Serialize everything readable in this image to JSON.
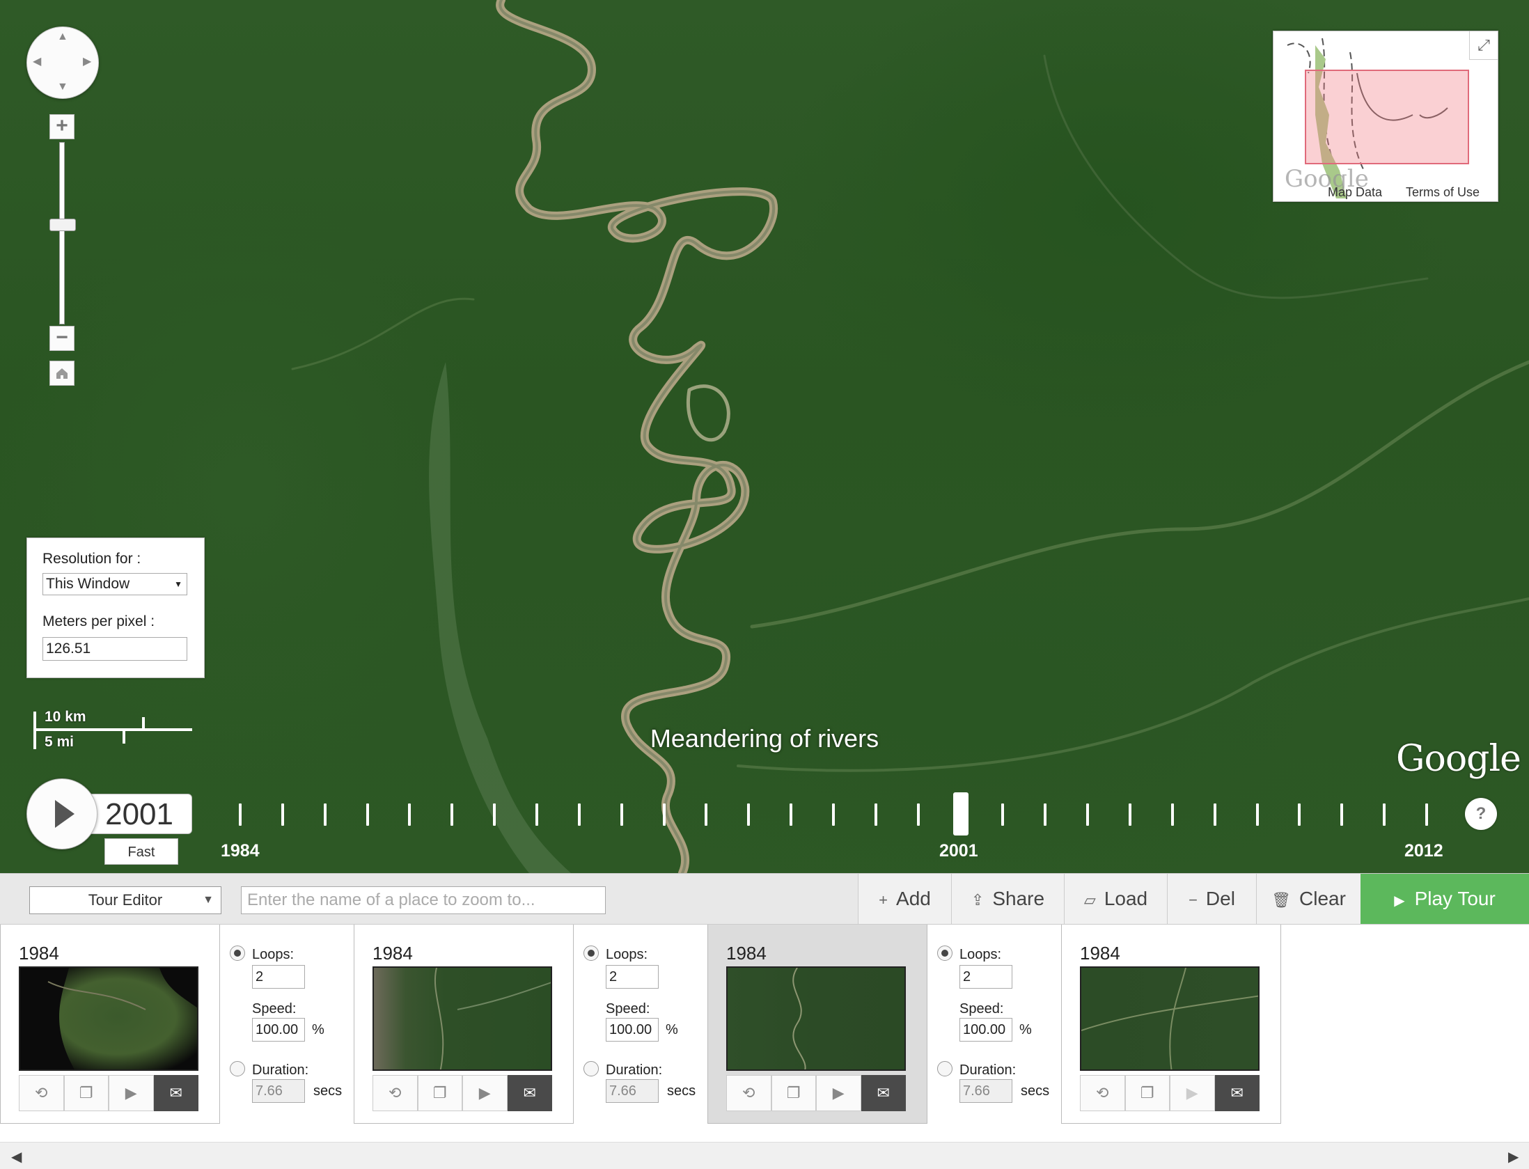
{
  "map": {
    "caption": "Meandering of rivers",
    "google_logo": "Google",
    "scale": {
      "metric": "10 km",
      "imperial": "5 mi"
    },
    "minimap": {
      "map_data": "Map Data",
      "terms": "Terms of Use",
      "logo": "Google"
    },
    "resolution_panel": {
      "resolution_label": "Resolution for :",
      "resolution_value": "This Window",
      "meters_label": "Meters per pixel :",
      "meters_value": "126.51"
    },
    "icons": [
      "pan-control-icon",
      "zoom-in-icon",
      "zoom-out-icon",
      "home-icon",
      "expand-icon",
      "help-icon",
      "play-icon"
    ]
  },
  "timeline": {
    "current_year": "2001",
    "speed_label": "Fast",
    "labels": {
      "start": "1984",
      "current": "2001",
      "end": "2012"
    },
    "help": "?"
  },
  "toolbar": {
    "mode": "Tour Editor",
    "search_placeholder": "Enter the name of a place to zoom to...",
    "add": "Add",
    "share": "Share",
    "load": "Load",
    "del": "Del",
    "clear": "Clear",
    "play_tour": "Play Tour"
  },
  "tour": {
    "keyframes": [
      {
        "year": "1984",
        "selected": false
      },
      {
        "year": "1984",
        "selected": false
      },
      {
        "year": "1984",
        "selected": true
      },
      {
        "year": "1984",
        "selected": false
      }
    ],
    "transitions": [
      {
        "loops_label": "Loops:",
        "loops": "2",
        "speed_label": "Speed:",
        "speed": "100.00",
        "speed_unit": "%",
        "duration_label": "Duration:",
        "duration": "7.66",
        "duration_unit": "secs"
      },
      {
        "loops_label": "Loops:",
        "loops": "2",
        "speed_label": "Speed:",
        "speed": "100.00",
        "speed_unit": "%",
        "duration_label": "Duration:",
        "duration": "7.66",
        "duration_unit": "secs"
      },
      {
        "loops_label": "Loops:",
        "loops": "2",
        "speed_label": "Speed:",
        "speed": "100.00",
        "speed_unit": "%",
        "duration_label": "Duration:",
        "duration": "7.66",
        "duration_unit": "secs"
      }
    ]
  },
  "colors": {
    "play_tour": "#5cb85c",
    "viewport": "#e06a7a",
    "forest": "#2d5825"
  }
}
